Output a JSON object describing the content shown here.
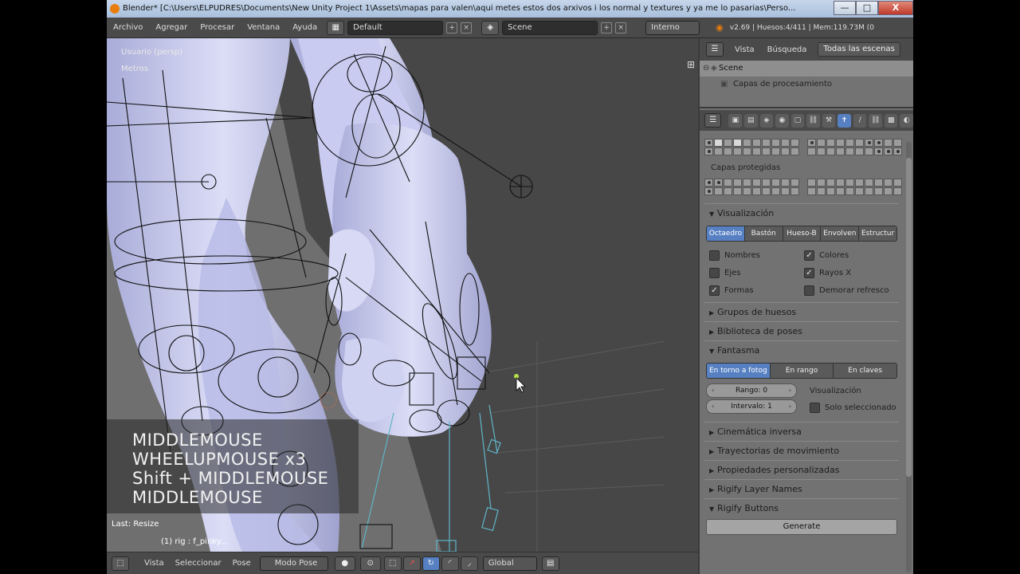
{
  "window": {
    "title": "Blender* [C:\\Users\\ELPUDRES\\Documents\\New Unity Project 1\\Assets\\mapas para valen\\aqui metes estos dos arxivos i los normal y textures y ya me lo pasarias\\Perso...",
    "min": "—",
    "max": "□",
    "close": "X"
  },
  "infobar": {
    "menus": [
      "Archivo",
      "Agregar",
      "Procesar",
      "Ventana",
      "Ayuda"
    ],
    "screen_layout": "Default",
    "scene": "Scene",
    "engine": "Interno",
    "stats": "v2.69 | Huesos:4/411 | Mem:119.73M (0"
  },
  "viewport": {
    "view_label": "Usuario (persp)",
    "units_label": "Metros",
    "key_history": [
      "MIDDLEMOUSE",
      "WHEELUPMOUSE x3",
      "Shift + MIDDLEMOUSE",
      "MIDDLEMOUSE"
    ],
    "last_operator": "Last: Resize",
    "active_bone": "(1) rig : f_pinky..."
  },
  "view_header": {
    "menus": [
      "Vista",
      "Seleccionar",
      "Pose"
    ],
    "mode": "Modo Pose",
    "orientation": "Global"
  },
  "outliner": {
    "menus": [
      "Vista",
      "Búsqueda"
    ],
    "filter": "Todas las escenas",
    "rows": [
      "Scene",
      "Capas de procesamiento"
    ]
  },
  "properties": {
    "protected_layers_label": "Capas protegidas",
    "visualization": {
      "title": "Visualización",
      "display_types": [
        "Octaedro",
        "Bastón",
        "Hueso-B",
        "Envolven",
        "Estructur"
      ],
      "active_display": "Octaedro",
      "options": [
        {
          "label": "Nombres",
          "checked": false
        },
        {
          "label": "Colores",
          "checked": true
        },
        {
          "label": "Ejes",
          "checked": false
        },
        {
          "label": "Rayos X",
          "checked": true
        },
        {
          "label": "Formas",
          "checked": true
        },
        {
          "label": "Demorar refresco",
          "checked": false
        }
      ]
    },
    "collapsed_sections_1": [
      "Grupos de huesos",
      "Biblioteca de poses"
    ],
    "ghost": {
      "title": "Fantasma",
      "modes": [
        "En torno a fotog",
        "En rango",
        "En claves"
      ],
      "active_mode": "En torno a fotog",
      "range": "Rango: 0",
      "interval": "Intervalo: 1",
      "display_label": "Visualización",
      "selected_only": "Solo seleccionado"
    },
    "collapsed_sections_2": [
      "Cinemática inversa",
      "Trayectorias de movimiento",
      "Propiedades personalizadas",
      "Rigify Layer Names"
    ],
    "rigify_buttons": {
      "title": "Rigify Buttons",
      "generate": "Generate"
    }
  },
  "colors": {
    "accent": "#5680c2",
    "mesh": "#c8cbf0",
    "viewport_bg": "#6f6f6f"
  }
}
